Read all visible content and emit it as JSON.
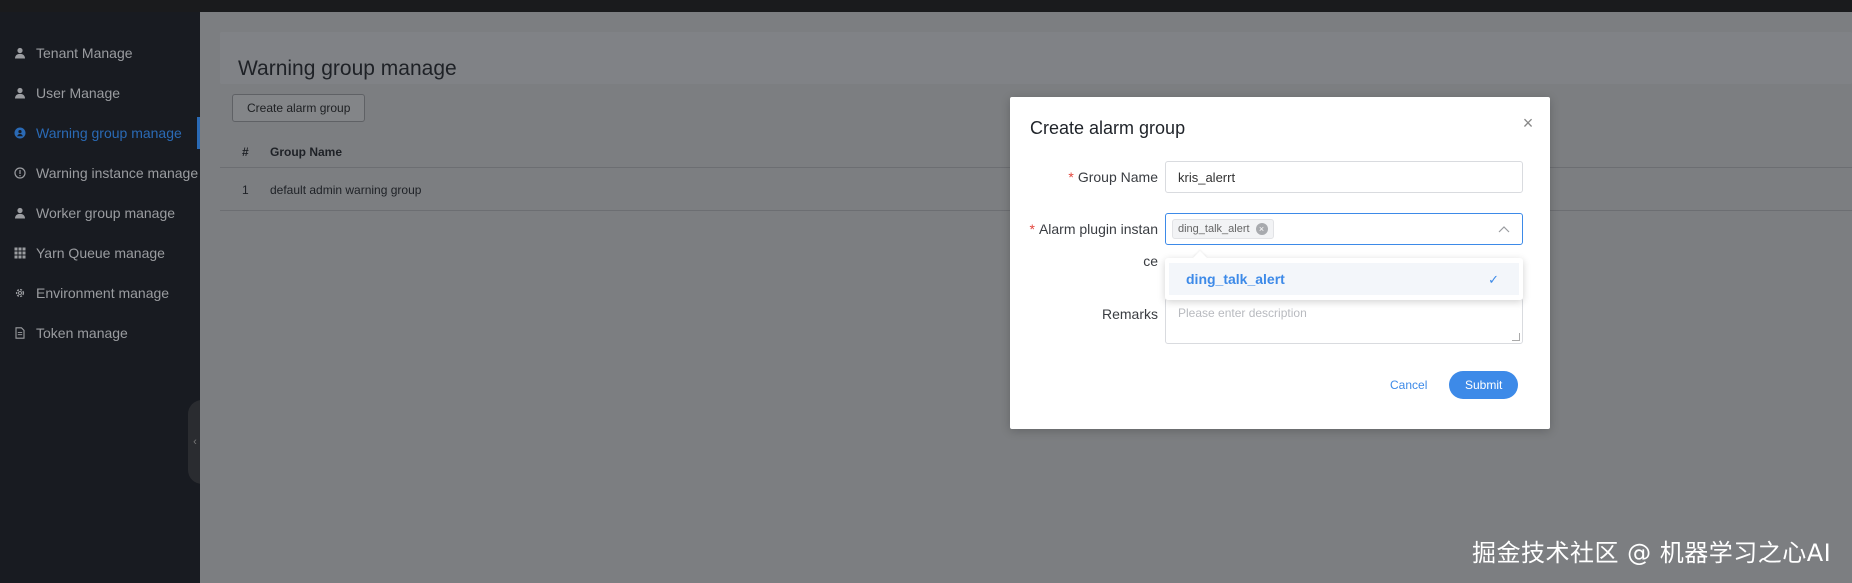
{
  "sidebar": {
    "items": [
      {
        "label": "Tenant Manage",
        "icon": "user-icon",
        "active": false
      },
      {
        "label": "User Manage",
        "icon": "user-icon",
        "active": false
      },
      {
        "label": "Warning group manage",
        "icon": "alert-group-icon",
        "active": true
      },
      {
        "label": "Warning instance manage",
        "icon": "info-circle-icon",
        "active": false
      },
      {
        "label": "Worker group manage",
        "icon": "user-icon",
        "active": false
      },
      {
        "label": "Yarn Queue manage",
        "icon": "grid-icon",
        "active": false
      },
      {
        "label": "Environment manage",
        "icon": "gear-icon",
        "active": false
      },
      {
        "label": "Token manage",
        "icon": "document-icon",
        "active": false
      }
    ]
  },
  "main": {
    "title": "Warning group manage",
    "create_button": "Create alarm group",
    "table": {
      "columns": [
        "#",
        "Group Name"
      ],
      "rows": [
        [
          "1",
          "default admin warning group"
        ]
      ]
    }
  },
  "modal": {
    "title": "Create alarm group",
    "group_name_label": "Group Name",
    "group_name_value": "kris_alerrt",
    "plugin_label_line1": "Alarm plugin instan",
    "plugin_label_line2": "ce",
    "plugin_tag": "ding_talk_alert",
    "dropdown_option": "ding_talk_alert",
    "remarks_label": "Remarks",
    "remarks_placeholder": "Please enter description",
    "cancel": "Cancel",
    "submit": "Submit"
  },
  "watermark": "掘金技术社区 @ 机器学习之心AI",
  "colors": {
    "accent": "#3d8ae8",
    "sidebar_bg": "#181b21",
    "required": "#e2453c"
  }
}
